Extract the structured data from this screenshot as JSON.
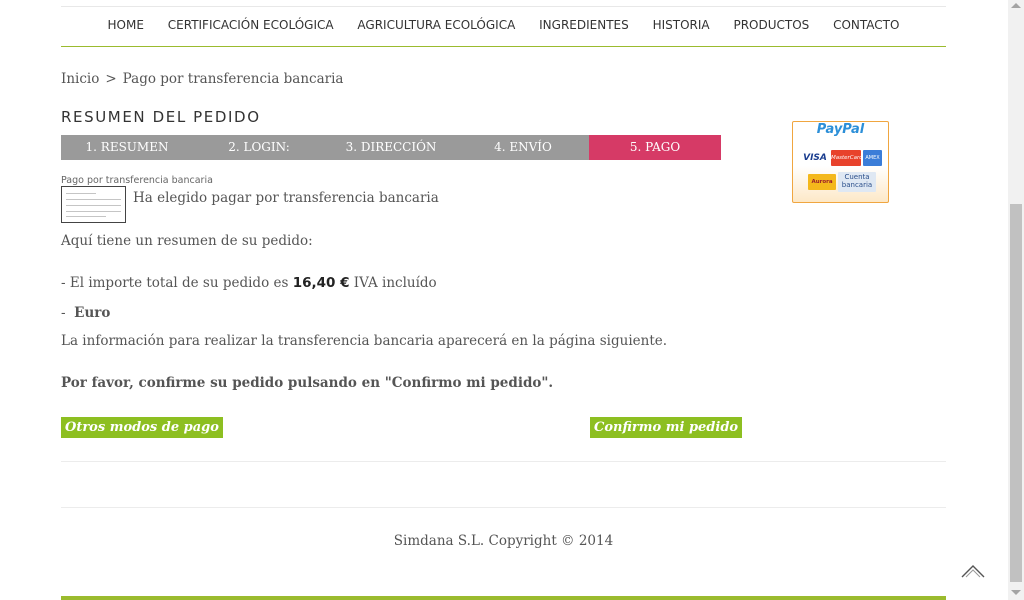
{
  "nav": {
    "items": [
      "HOME",
      "CERTIFICACIÓN ECOLÓGICA",
      "AGRICULTURA ECOLÓGICA",
      "INGREDIENTES",
      "HISTORIA",
      "PRODUCTOS",
      "CONTACTO"
    ]
  },
  "breadcrumb": {
    "home": "Inicio",
    "separator": ">",
    "current": "Pago por transferencia bancaria"
  },
  "page_title": "RESUMEN DEL PEDIDO",
  "steps": [
    {
      "label": "1. RESUMEN",
      "active": false
    },
    {
      "label": "2. LOGIN:",
      "active": false
    },
    {
      "label": "3. DIRECCIÓN",
      "active": false
    },
    {
      "label": "4. ENVÍO",
      "active": false
    },
    {
      "label": "5. PAGO",
      "active": true
    }
  ],
  "payment": {
    "method_label": "Pago por transferencia bancaria",
    "chosen_text": "Ha elegido pagar por transferencia bancaria"
  },
  "summary": {
    "intro": "Aquí tiene un resumen de su pedido:",
    "total_prefix": "- El importe total de su pedido es",
    "total_amount": "16,40 €",
    "total_suffix": "IVA incluído",
    "currency_prefix": "-",
    "currency": "Euro",
    "info": "La información para realizar la transferencia bancaria aparecerá en la página siguiente.",
    "confirm_prompt": "Por favor, confirme su pedido pulsando en \"Confirmo mi pedido\"."
  },
  "buttons": {
    "other_methods": "Otros modos de pago",
    "confirm": "Confirmo mi pedido"
  },
  "sidebar": {
    "paypal_logo": "PayPal",
    "cards": [
      "VISA",
      "MasterCard",
      "AMEX",
      "Aurora",
      "Cuenta bancaria"
    ]
  },
  "footer": {
    "copyright": "Simdana S.L. Copyright © 2014"
  },
  "colors": {
    "accent_green": "#8dbf21",
    "active_step": "#d63a66",
    "step_gray": "#9a9a9a",
    "nav_line": "#9bbb2e"
  },
  "icons": {
    "scroll_top": "chevron-up-icon"
  }
}
